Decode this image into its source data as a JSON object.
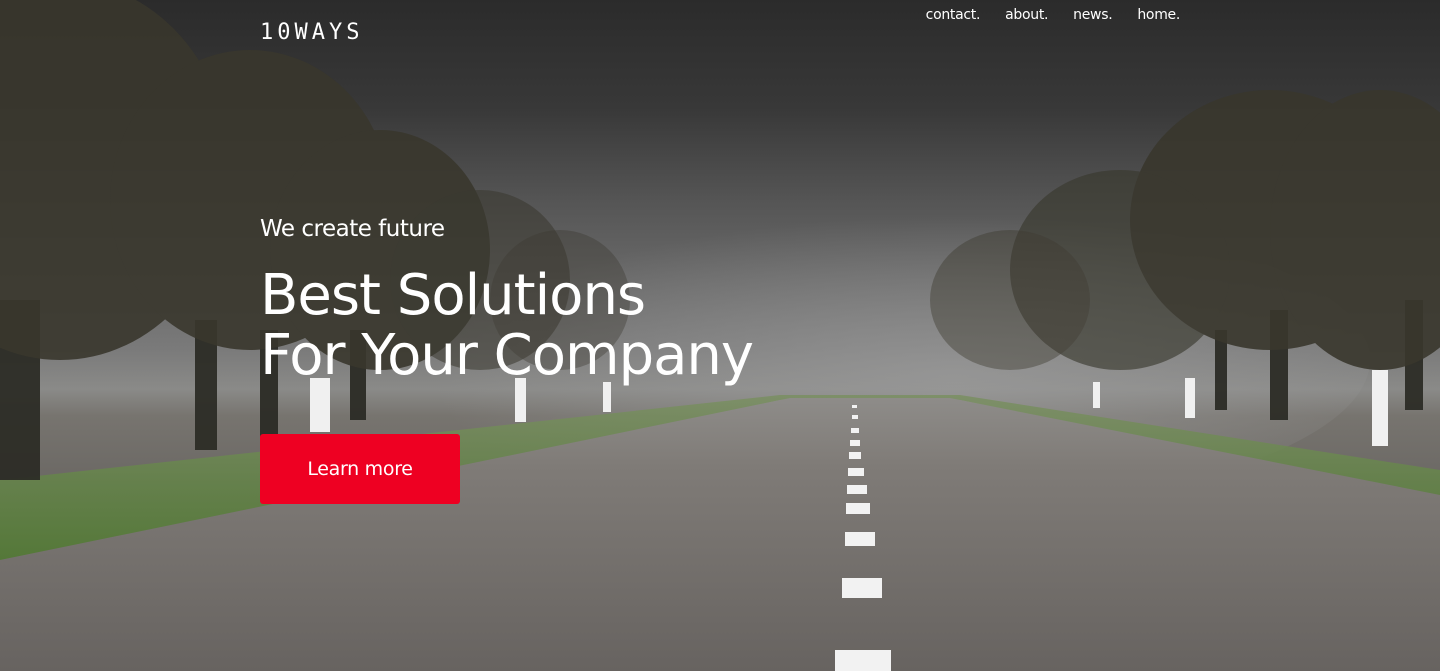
{
  "brand": {
    "logo_text": "10WAYS"
  },
  "nav": {
    "items": [
      "contact.",
      "about.",
      "news.",
      "home."
    ]
  },
  "hero": {
    "tagline": "We create future",
    "headline_line1": "Best Solutions",
    "headline_line2": "For Your Company",
    "cta_label": "Learn more"
  },
  "colors": {
    "accent": "#EE0022",
    "text": "#FFFFFF"
  }
}
